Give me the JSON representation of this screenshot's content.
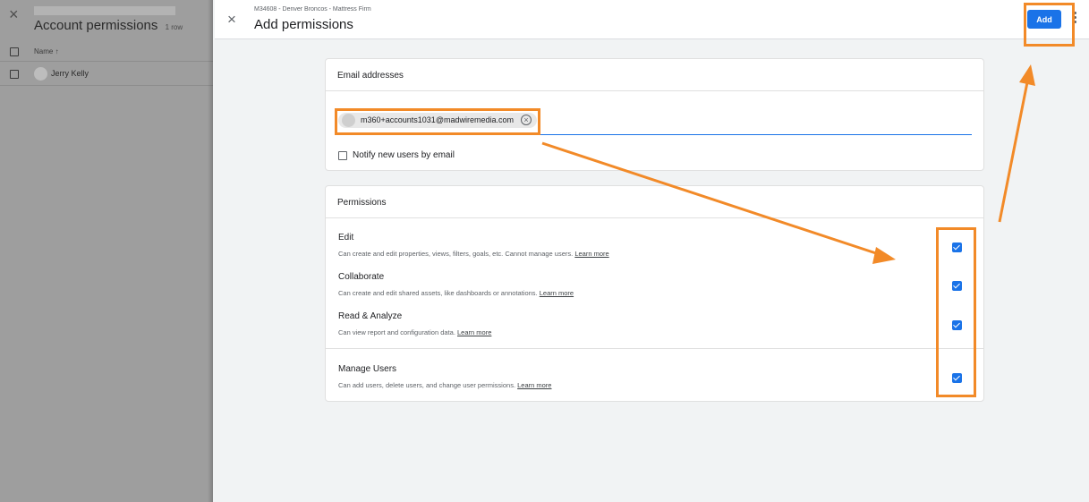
{
  "left_panel": {
    "title": "Account permissions",
    "row_count": "1 row",
    "column_name": "Name ↑",
    "rows": [
      {
        "name": "Jerry Kelly"
      }
    ]
  },
  "header": {
    "breadcrumb": "M34608 - Denver Broncos - Mattress Firm",
    "title": "Add permissions",
    "add_label": "Add"
  },
  "email_card": {
    "heading": "Email addresses",
    "chip_email": "m360+accounts1031@madwiremedia.com",
    "notify_label": "Notify new users by email",
    "notify_checked": false
  },
  "permissions_card": {
    "heading": "Permissions",
    "items": [
      {
        "title": "Edit",
        "desc": "Can create and edit properties, views, filters, goals, etc. Cannot manage users.",
        "link": "Learn more",
        "checked": true
      },
      {
        "title": "Collaborate",
        "desc": "Can create and edit shared assets, like dashboards or annotations.",
        "link": "Learn more",
        "checked": true
      },
      {
        "title": "Read & Analyze",
        "desc": "Can view report and configuration data.",
        "link": "Learn more",
        "checked": true
      },
      {
        "title": "Manage Users",
        "desc": "Can add users, delete users, and change user permissions.",
        "link": "Learn more",
        "checked": true
      }
    ]
  },
  "colors": {
    "accent": "#1a73e8",
    "annotation": "#f28a28",
    "overlay": "#9e9e9e"
  }
}
